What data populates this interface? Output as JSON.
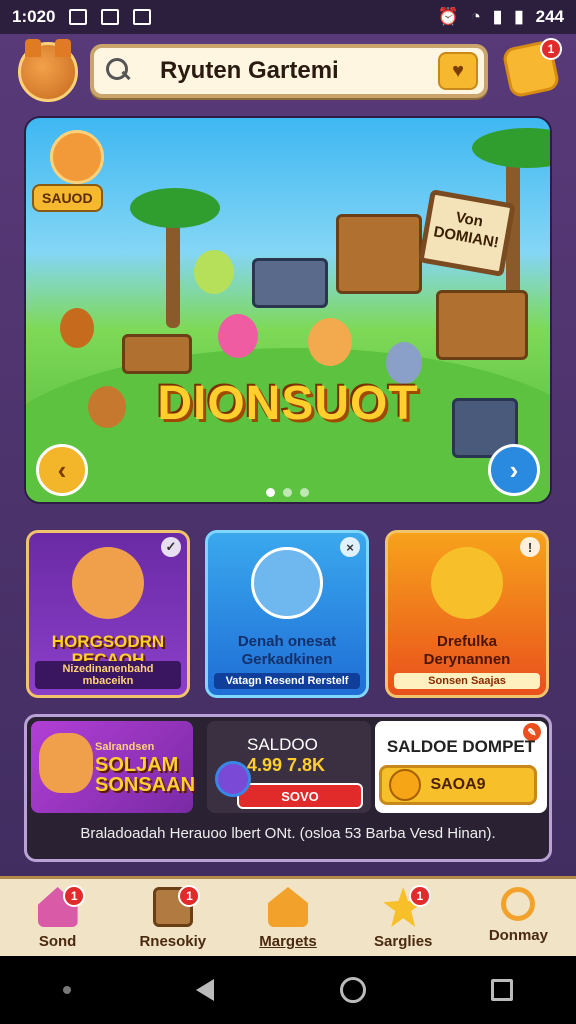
{
  "status_bar": {
    "time": "1:020",
    "battery": "244",
    "icons": [
      "gallery-icon",
      "image-icon",
      "notification-icon",
      "alarm-icon",
      "wifi-icon",
      "signal-icon",
      "battery-icon"
    ]
  },
  "header": {
    "search_text": "Ryuten Gartemi",
    "notification_count": "1"
  },
  "hero": {
    "tag": "SAUOD",
    "title": "DIONSUOT",
    "sign_text": "Von DOMIAN!",
    "prev_icon": "chevron-left-icon",
    "next_icon": "chevron-right-icon",
    "page_count": 3,
    "active_page": 1
  },
  "cards": [
    {
      "title": "HORGSODRN PECAOH",
      "subtitle": "Nizedinanenbahd mbaceikn",
      "corner": "✓"
    },
    {
      "title": "Denah onesat Gerkadkinen",
      "subtitle": "Vatagn Resend Rerstelf",
      "corner": "×"
    },
    {
      "title": "Drefulka Derynannen",
      "subtitle": "Sonsen Saajas",
      "corner": "!"
    }
  ],
  "wallet": {
    "promo_title": "Salrandsen",
    "promo_big": "SOLJAM SONSAAN",
    "saldo_label": "SALDOO",
    "saldo_value": "4.99 7.8K",
    "saldo_button": "SOVO",
    "dompet_label": "SALDOE DOMPET",
    "dompet_button": "SAOA9",
    "note": "Braladoadah Herauoo lbert ONt. (osloa 53 Barba Vesd Hinan)."
  },
  "bottom_nav": [
    {
      "label": "Sond",
      "badge": "1"
    },
    {
      "label": "Rnesokiy",
      "badge": "1"
    },
    {
      "label": "Margets",
      "badge": ""
    },
    {
      "label": "Sarglies",
      "badge": "1"
    },
    {
      "label": "Donmay",
      "badge": ""
    }
  ]
}
